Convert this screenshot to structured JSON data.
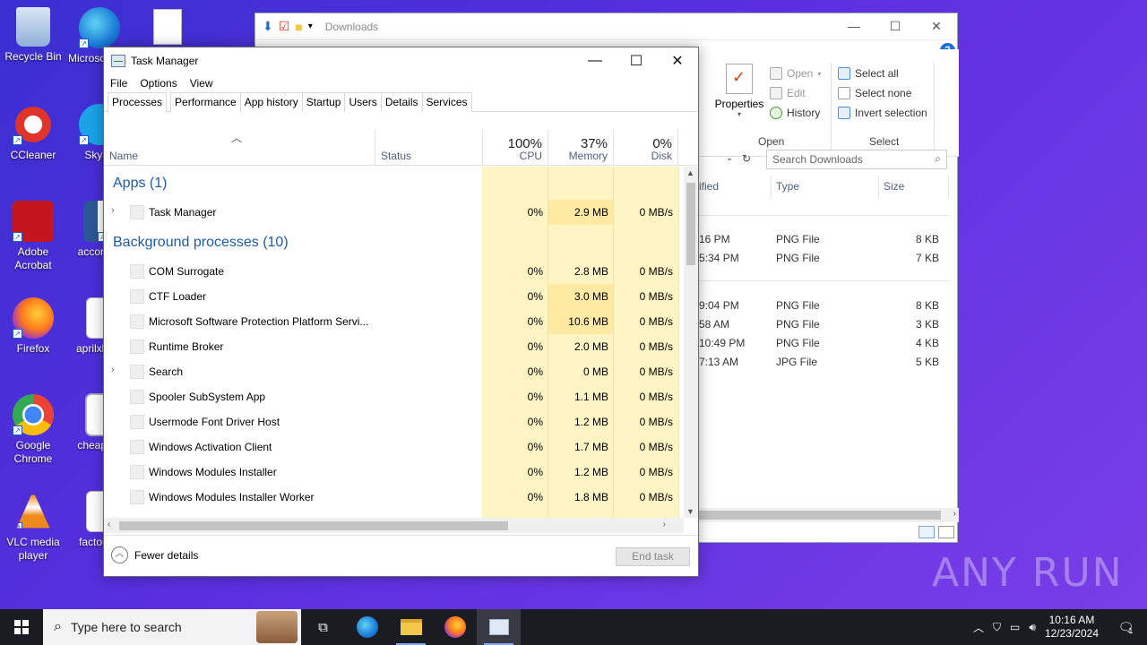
{
  "desktop": {
    "icons": [
      {
        "label": "Recycle Bin"
      },
      {
        "label": "Microsoft Edge"
      },
      {
        "label": "CCleaner"
      },
      {
        "label": "Skype"
      },
      {
        "label": "Adobe Acrobat"
      },
      {
        "label": "accordi..."
      },
      {
        "label": "Firefox"
      },
      {
        "label": "aprilxbo..."
      },
      {
        "label": "Google Chrome"
      },
      {
        "label": "cheapb..."
      },
      {
        "label": "VLC media player"
      },
      {
        "label": "factors..."
      }
    ]
  },
  "explorer": {
    "title": "Downloads",
    "ribbon": {
      "open_group": {
        "properties": "Properties",
        "open": "Open",
        "edit": "Edit",
        "history": "History",
        "label": "Open"
      },
      "select_group": {
        "select_all": "Select all",
        "select_none": "Select none",
        "invert": "Invert selection",
        "label": "Select"
      }
    },
    "search_placeholder": "Search Downloads",
    "columns": {
      "modified": "ified",
      "type": "Type",
      "size": "Size"
    },
    "rows": [
      {
        "time": "16 PM",
        "type": "PNG File",
        "size": "8 KB"
      },
      {
        "time": "5:34 PM",
        "type": "PNG File",
        "size": "7 KB"
      },
      {
        "time": "9:04 PM",
        "type": "PNG File",
        "size": "8 KB"
      },
      {
        "time": "58 AM",
        "type": "PNG File",
        "size": "3 KB"
      },
      {
        "time": "10:49 PM",
        "type": "PNG File",
        "size": "4 KB"
      },
      {
        "time": "7:13 AM",
        "type": "JPG File",
        "size": "5 KB"
      }
    ]
  },
  "taskmgr": {
    "title": "Task Manager",
    "menu": [
      "File",
      "Options",
      "View"
    ],
    "tabs": [
      "Processes",
      "Performance",
      "App history",
      "Startup",
      "Users",
      "Details",
      "Services"
    ],
    "header": {
      "name": "Name",
      "status": "Status",
      "cpu_pct": "100%",
      "cpu": "CPU",
      "mem_pct": "37%",
      "memory": "Memory",
      "disk_pct": "0%",
      "disk": "Disk"
    },
    "apps_group": "Apps (1)",
    "apps": [
      {
        "name": "Task Manager",
        "cpu": "0%",
        "mem": "2.9 MB",
        "disk": "0 MB/s"
      }
    ],
    "bg_group": "Background processes (10)",
    "background": [
      {
        "name": "COM Surrogate",
        "cpu": "0%",
        "mem": "2.8 MB",
        "disk": "0 MB/s"
      },
      {
        "name": "CTF Loader",
        "cpu": "0%",
        "mem": "3.0 MB",
        "disk": "0 MB/s"
      },
      {
        "name": "Microsoft Software Protection Platform Servi...",
        "cpu": "0%",
        "mem": "10.6 MB",
        "disk": "0 MB/s"
      },
      {
        "name": "Runtime Broker",
        "cpu": "0%",
        "mem": "2.0 MB",
        "disk": "0 MB/s"
      },
      {
        "name": "Search",
        "cpu": "0%",
        "mem": "0 MB",
        "disk": "0 MB/s"
      },
      {
        "name": "Spooler SubSystem App",
        "cpu": "0%",
        "mem": "1.1 MB",
        "disk": "0 MB/s"
      },
      {
        "name": "Usermode Font Driver Host",
        "cpu": "0%",
        "mem": "1.2 MB",
        "disk": "0 MB/s"
      },
      {
        "name": "Windows Activation Client",
        "cpu": "0%",
        "mem": "1.7 MB",
        "disk": "0 MB/s"
      },
      {
        "name": "Windows Modules Installer",
        "cpu": "0%",
        "mem": "1.2 MB",
        "disk": "0 MB/s"
      },
      {
        "name": "Windows Modules Installer Worker",
        "cpu": "0%",
        "mem": "1.8 MB",
        "disk": "0 MB/s"
      }
    ],
    "fewer_details": "Fewer details",
    "end_task": "End task"
  },
  "watermark": "ANY RUN",
  "taskbar": {
    "search_placeholder": "Type here to search",
    "time": "10:16 AM",
    "date": "12/23/2024",
    "notification_count": "1"
  },
  "colors": {
    "desktop": "#4a34d8",
    "heat_light": "#fff4c4",
    "heat_mid": "#ffe9a3",
    "group_blue": "#1e5aa8"
  }
}
